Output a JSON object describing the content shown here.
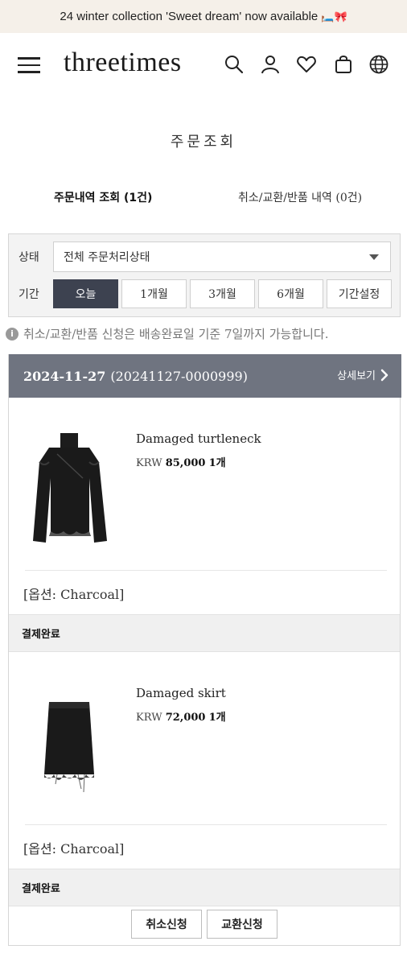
{
  "banner": {
    "text": "24 winter collection 'Sweet dream' now available",
    "emoji": "🛏️🎀"
  },
  "header": {
    "logo": "threetimes",
    "icons": [
      "menu-icon",
      "search-icon",
      "user-icon",
      "heart-icon",
      "bag-icon",
      "globe-icon"
    ]
  },
  "page": {
    "title": "주문조회"
  },
  "tabs": [
    {
      "label": "주문내역 조회 (1건)",
      "active": true
    },
    {
      "label": "취소/교환/반품 내역 (0건)",
      "active": false
    }
  ],
  "filter": {
    "status_label": "상태",
    "status_value": "전체 주문처리상태",
    "period_label": "기간",
    "periods": [
      "오늘",
      "1개월",
      "3개월",
      "6개월",
      "기간설정"
    ],
    "active_period": "오늘"
  },
  "notice": "취소/교환/반품 신청은 배송완료일 기준 7일까지 가능합니다.",
  "order": {
    "date": "2024-11-27",
    "number": "(20241127-0000999)",
    "detail_label": "상세보기",
    "items": [
      {
        "name": "Damaged turtleneck",
        "currency": "KRW",
        "price": "85,000",
        "qty": "1개",
        "option": "[옵션: Charcoal]",
        "status": "결제완료"
      },
      {
        "name": "Damaged skirt",
        "currency": "KRW",
        "price": "72,000",
        "qty": "1개",
        "option": "[옵션: Charcoal]",
        "status": "결제완료"
      }
    ],
    "actions": {
      "cancel": "취소신청",
      "exchange": "교환신청"
    }
  },
  "colors": {
    "accent_dark": "#3d4250",
    "order_header": "#6f7480",
    "banner_bg": "#f5f0e9"
  }
}
